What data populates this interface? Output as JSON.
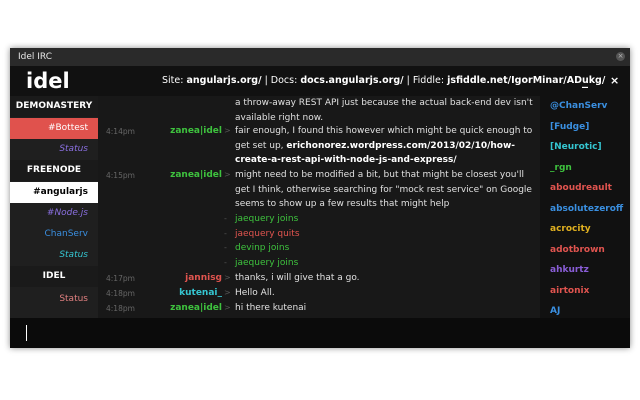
{
  "window": {
    "title": "Idel IRC",
    "close_glyph": "×"
  },
  "header": {
    "brand": "idel",
    "topic": {
      "site_label": "Site: ",
      "site": "angularjs.org/",
      "sep1": " | Docs: ",
      "docs": "docs.angularjs.org/",
      "sep2": " | Fiddle: ",
      "fiddle": "jsfiddle.net/IgorMinar/ADukg/"
    },
    "minimize_glyph": "_",
    "close_glyph": "×"
  },
  "nav": [
    {
      "label": "DEMONASTERY",
      "type": "server"
    },
    {
      "label": "#Bottest",
      "type": "channel-active"
    },
    {
      "label": "Status",
      "type": "status"
    },
    {
      "label": "FREENODE",
      "type": "server"
    },
    {
      "label": "#angularjs",
      "type": "channel-selected"
    },
    {
      "label": "#Node.js",
      "type": "channel"
    },
    {
      "label": "ChanServ",
      "type": "query"
    },
    {
      "label": "Status",
      "type": "status"
    },
    {
      "label": "IDEL",
      "type": "server"
    },
    {
      "label": "Status",
      "type": "status-muted"
    }
  ],
  "log": [
    {
      "time": "",
      "nick": "",
      "arrow": "",
      "msg": [
        "a throw-away REST API just because the actual back-end dev isn't available right now."
      ]
    },
    {
      "time": "4:14pm",
      "nick": "zanea|idel",
      "nick_color": "#3ec23e",
      "arrow": ">",
      "msg": [
        "fair enough, I found this however which might be quick enough to get set up, ",
        "erichonorez.wordpress.com/2013/02/10/how-create-a-rest-api-with-node-js-and-express/"
      ]
    },
    {
      "time": "4:15pm",
      "nick": "zanea|idel",
      "nick_color": "#3ec23e",
      "arrow": ">",
      "msg": [
        "might need to be modified a bit, but that might be closest you'll get I think, otherwise searching for \"mock rest service\" on Google seems to show up a few results that might help"
      ]
    },
    {
      "time": "",
      "nick": "",
      "arrow": "-",
      "msg": [
        "jaequery joins"
      ],
      "msg_color": "#3ec23e"
    },
    {
      "time": "",
      "nick": "",
      "arrow": "-",
      "msg": [
        "jaequery quits"
      ],
      "msg_color": "#e0544f"
    },
    {
      "time": "",
      "nick": "",
      "arrow": "-",
      "msg": [
        "devinp joins"
      ],
      "msg_color": "#3ec23e"
    },
    {
      "time": "",
      "nick": "",
      "arrow": "-",
      "msg": [
        "jaequery joins"
      ],
      "msg_color": "#3ec23e"
    },
    {
      "time": "4:17pm",
      "nick": "jannisg",
      "nick_color": "#e0544f",
      "arrow": ">",
      "msg": [
        "thanks, i will give that a go."
      ]
    },
    {
      "time": "4:18pm",
      "nick": "kutenai_",
      "nick_color": "#35c6d1",
      "arrow": ">",
      "msg": [
        "Hello All."
      ]
    },
    {
      "time": "4:18pm",
      "nick": "zanea|idel",
      "nick_color": "#3ec23e",
      "arrow": ">",
      "msg": [
        "hi there kutenai"
      ]
    }
  ],
  "users": [
    {
      "name": "@ChanServ",
      "color": "#3a8fe0"
    },
    {
      "name": "[Fudge]",
      "color": "#3a8fe0"
    },
    {
      "name": "[Neurotic]",
      "color": "#35c6d1"
    },
    {
      "name": "_rgn",
      "color": "#3ec23e"
    },
    {
      "name": "aboudreault",
      "color": "#e0544f"
    },
    {
      "name": "absolutezeroff",
      "color": "#3a8fe0"
    },
    {
      "name": "acrocity",
      "color": "#e0b020"
    },
    {
      "name": "adotbrown",
      "color": "#e0544f"
    },
    {
      "name": "ahkurtz",
      "color": "#8a5ed8"
    },
    {
      "name": "airtonix",
      "color": "#e0544f"
    },
    {
      "name": "AJ",
      "color": "#3a8fe0"
    }
  ],
  "colors": {
    "accent_red": "#e0524d",
    "channel_purple": "#8a6fe0",
    "status_muted": "#e08080"
  }
}
